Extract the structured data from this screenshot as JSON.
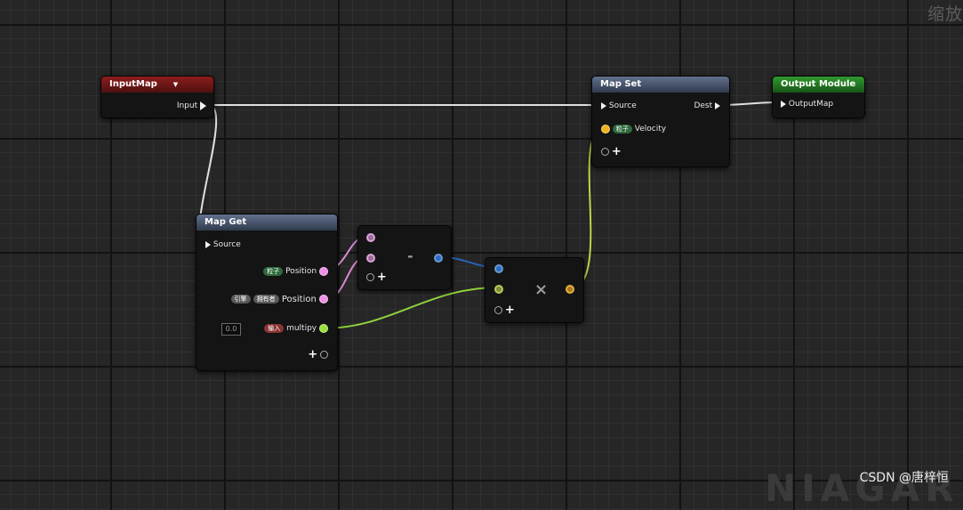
{
  "zoom_label": "缩放",
  "watermark": "NIAGAR",
  "credit": "CSDN @唐梓恒",
  "colors": {
    "exec_wire": "#e0e0e0",
    "position_wire": "#d98ad4",
    "vector_wire": "#2a63b3",
    "float_wire": "#8fd13d",
    "velocity_wire": "#b8d84a",
    "input_header": "#8e1d1d",
    "map_header": "#62718c",
    "output_header": "#2f9a2f"
  },
  "nodes": {
    "input_map": {
      "title": "InputMap",
      "dropdown_icon": "triangle-down",
      "output_label": "Input"
    },
    "map_get": {
      "title": "Map Get",
      "source_label": "Source",
      "pin1": {
        "badge": "粒子",
        "label": "Position"
      },
      "pin2": {
        "badge1": "引擎",
        "badge2": "拥有者",
        "label": "Position"
      },
      "pin3": {
        "default_value": "0.0",
        "badge": "输入",
        "label": "multipy"
      }
    },
    "subtract": {
      "symbol": "-"
    },
    "multiply": {
      "symbol": "×"
    },
    "map_set": {
      "title": "Map Set",
      "source_label": "Source",
      "dest_label": "Dest",
      "pin1": {
        "badge": "粒子",
        "label": "Velocity"
      }
    },
    "output_module": {
      "title": "Output Module",
      "input_label": "OutputMap"
    }
  }
}
